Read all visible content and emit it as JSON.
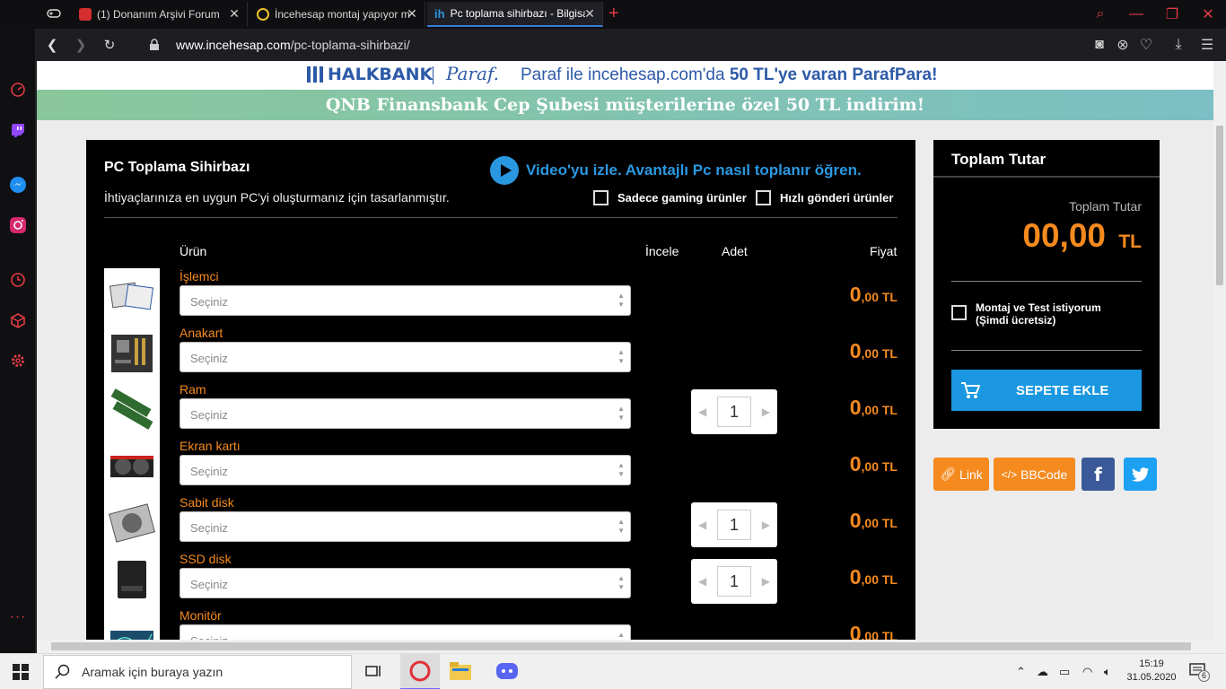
{
  "browser": {
    "tabs": [
      {
        "label": "(1) Donanım Arşivi Forum"
      },
      {
        "label": "İncehesap montaj yapıyor mu"
      },
      {
        "label": "Pc toplama sihirbazı - Bilgisayar"
      }
    ],
    "url_domain": "www.incehesap.com",
    "url_path": "/pc-toplama-sihirbazi/"
  },
  "banners": {
    "bank_logo": "HALKBANK",
    "paraf_logo": "Paraf.",
    "promo_pre": "Paraf ile incehesap.com'da ",
    "promo_bold": "50 TL'ye varan ParafPara!",
    "qnb": "QNB Finansbank Cep Şubesi müşterilerine özel 50 TL indirim!"
  },
  "wizard": {
    "title": "PC Toplama Sihirbazı",
    "subtitle": "İhtiyaçlarınıza en uygun PC'yi oluşturmanız için tasarlanmıştır.",
    "video_link": "Video'yu izle. Avantajlı Pc nasıl toplanır öğren.",
    "filter_gaming": "Sadece gaming ürünler",
    "filter_fast": "Hızlı gönderi ürünler",
    "col_product": "Ürün",
    "col_review": "İncele",
    "col_qty": "Adet",
    "col_price": "Fiyat",
    "select_placeholder": "Seçiniz",
    "rows": [
      {
        "label": "İşlemci",
        "price_int": "0",
        "price_dec": ",00 TL",
        "qty": null
      },
      {
        "label": "Anakart",
        "price_int": "0",
        "price_dec": ",00 TL",
        "qty": null
      },
      {
        "label": "Ram",
        "price_int": "0",
        "price_dec": ",00 TL",
        "qty": "1"
      },
      {
        "label": "Ekran kartı",
        "price_int": "0",
        "price_dec": ",00 TL",
        "qty": null
      },
      {
        "label": "Sabit disk",
        "price_int": "0",
        "price_dec": ",00 TL",
        "qty": "1"
      },
      {
        "label": "SSD disk",
        "price_int": "0",
        "price_dec": ",00 TL",
        "qty": "1"
      },
      {
        "label": "Monitör",
        "price_int": "0",
        "price_dec": ",00 TL",
        "qty": null
      }
    ]
  },
  "total": {
    "header": "Toplam Tutar",
    "label": "Toplam Tutar",
    "amount": "00,00",
    "currency": "TL",
    "montaj": "Montaj ve Test istiyorum (Şimdi ücretsiz)",
    "add_to_cart": "SEPETE EKLE"
  },
  "share": {
    "link": "Link",
    "bbcode": "BBCode"
  },
  "taskbar": {
    "search_placeholder": "Aramak için buraya yazın",
    "time": "15:19",
    "date": "31.05.2020",
    "notif": "6"
  },
  "colors": {
    "accent_orange": "#f58a1f",
    "accent_blue": "#1a97e0",
    "facebook": "#3b5998",
    "twitter": "#1da1f2"
  }
}
